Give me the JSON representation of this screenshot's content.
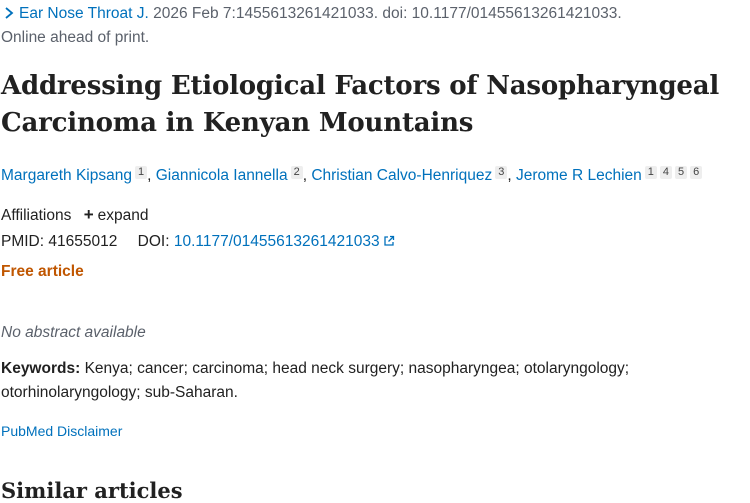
{
  "citation": {
    "journal": "Ear Nose Throat J.",
    "details": " 2026 Feb 7:1455613261421033. doi: 10.1177/01455613261421033."
  },
  "print_note": "Online ahead of print.",
  "title": "Addressing Etiological Factors of Nasopharyngeal Carcinoma in Kenyan Mountains",
  "authors": [
    {
      "name": "Margareth Kipsang",
      "affils": [
        "1"
      ]
    },
    {
      "name": "Giannicola Iannella",
      "affils": [
        "2"
      ]
    },
    {
      "name": "Christian Calvo-Henriquez",
      "affils": [
        "3"
      ]
    },
    {
      "name": "Jerome R Lechien",
      "affils": [
        "1",
        "4",
        "5",
        "6"
      ]
    }
  ],
  "author_separator": ", ",
  "affiliations": {
    "label": "Affiliations",
    "expand_label": "expand"
  },
  "identifiers": {
    "pmid_label": "PMID:",
    "pmid": "41655012",
    "doi_label": "DOI:",
    "doi": "10.1177/01455613261421033"
  },
  "free_article": "Free article",
  "no_abstract": "No abstract available",
  "keywords": {
    "label": "Keywords:",
    "text": "Kenya; cancer; carcinoma; head neck surgery; nasopharyngea; otolaryngology; otorhinolaryngology; sub-Saharan."
  },
  "disclaimer": "PubMed Disclaimer",
  "similar_heading": "Similar articles",
  "colors": {
    "link": "#0071bc",
    "free": "#c05600",
    "muted": "#5b616b"
  },
  "icons": {
    "citation": "chevron-right-icon",
    "doi_link": "external-link-icon",
    "expand": "plus-icon"
  }
}
